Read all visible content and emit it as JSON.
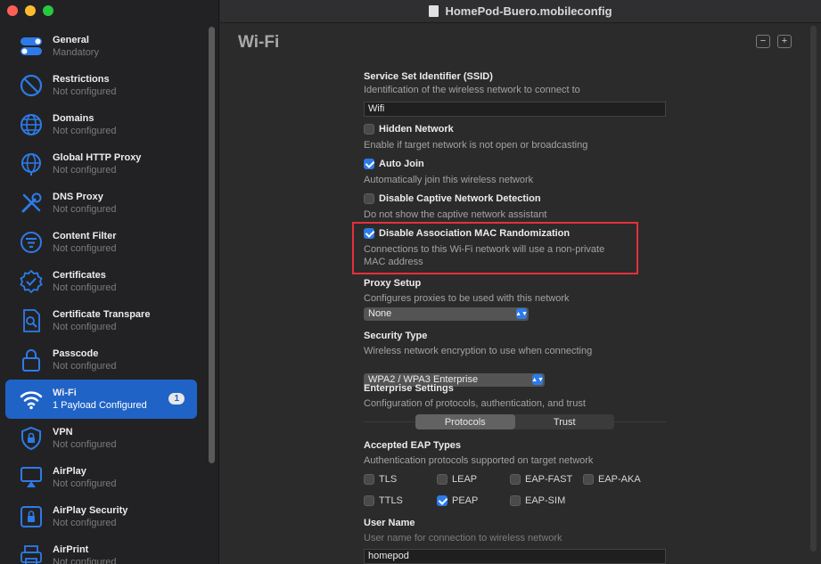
{
  "window": {
    "title": "HomePod-Buero.mobileconfig"
  },
  "sidebar": {
    "items": [
      {
        "title": "General",
        "subtitle": "Mandatory",
        "icon": "toggle-icon"
      },
      {
        "title": "Restrictions",
        "subtitle": "Not configured",
        "icon": "prohibited-icon"
      },
      {
        "title": "Domains",
        "subtitle": "Not configured",
        "icon": "globe-icon"
      },
      {
        "title": "Global HTTP Proxy",
        "subtitle": "Not configured",
        "icon": "globe-network-icon"
      },
      {
        "title": "DNS Proxy",
        "subtitle": "Not configured",
        "icon": "tools-icon"
      },
      {
        "title": "Content Filter",
        "subtitle": "Not configured",
        "icon": "filter-icon"
      },
      {
        "title": "Certificates",
        "subtitle": "Not configured",
        "icon": "certificate-badge-icon"
      },
      {
        "title": "Certificate Transpare",
        "subtitle": "Not configured",
        "icon": "document-search-icon"
      },
      {
        "title": "Passcode",
        "subtitle": "Not configured",
        "icon": "lock-icon"
      },
      {
        "title": "Wi-Fi",
        "subtitle": "1 Payload Configured",
        "icon": "wifi-icon",
        "badge": "1",
        "active": true
      },
      {
        "title": "VPN",
        "subtitle": "Not configured",
        "icon": "vpn-shield-icon"
      },
      {
        "title": "AirPlay",
        "subtitle": "Not configured",
        "icon": "airplay-icon"
      },
      {
        "title": "AirPlay Security",
        "subtitle": "Not configured",
        "icon": "airplay-lock-icon"
      },
      {
        "title": "AirPrint",
        "subtitle": "Not configured",
        "icon": "printer-icon"
      }
    ]
  },
  "main": {
    "title": "Wi-Fi",
    "remove_label": "−",
    "add_label": "+",
    "ssid": {
      "label": "Service Set Identifier (SSID)",
      "desc": "Identification of the wireless network to connect to",
      "value": "Wifi"
    },
    "hidden_network": {
      "label": "Hidden Network",
      "desc": "Enable if target network is not open or broadcasting",
      "checked": false
    },
    "auto_join": {
      "label": "Auto Join",
      "desc": "Automatically join this wireless network",
      "checked": true
    },
    "captive": {
      "label": "Disable Captive Network Detection",
      "desc": "Do not show the captive network assistant",
      "checked": false
    },
    "mac_random": {
      "label": "Disable Association MAC Randomization",
      "desc_line1": "Connections to this Wi-Fi network will use a non-private",
      "desc_line2": "MAC address",
      "checked": true
    },
    "proxy": {
      "label": "Proxy Setup",
      "desc": "Configures proxies to be used with this network",
      "value": "None"
    },
    "security": {
      "label": "Security Type",
      "desc": "Wireless network encryption to use when connecting",
      "value": "WPA2 / WPA3 Enterprise"
    },
    "enterprise": {
      "label": "Enterprise Settings",
      "desc": "Configuration of protocols, authentication, and trust",
      "tabs": [
        "Protocols",
        "Trust"
      ],
      "selected_tab": "Protocols"
    },
    "eap": {
      "label": "Accepted EAP Types",
      "desc": "Authentication protocols supported on target network",
      "types": [
        {
          "name": "TLS",
          "checked": false
        },
        {
          "name": "LEAP",
          "checked": false
        },
        {
          "name": "EAP-FAST",
          "checked": false
        },
        {
          "name": "EAP-AKA",
          "checked": false
        },
        {
          "name": "TTLS",
          "checked": false
        },
        {
          "name": "PEAP",
          "checked": true
        },
        {
          "name": "EAP-SIM",
          "checked": false
        }
      ]
    },
    "username": {
      "label": "User Name",
      "desc": "User name for connection to wireless network",
      "value": "homepod"
    }
  },
  "colors": {
    "accent": "#2d7be8",
    "sidebar_active": "#1f63c6",
    "highlight": "#e5303b"
  }
}
